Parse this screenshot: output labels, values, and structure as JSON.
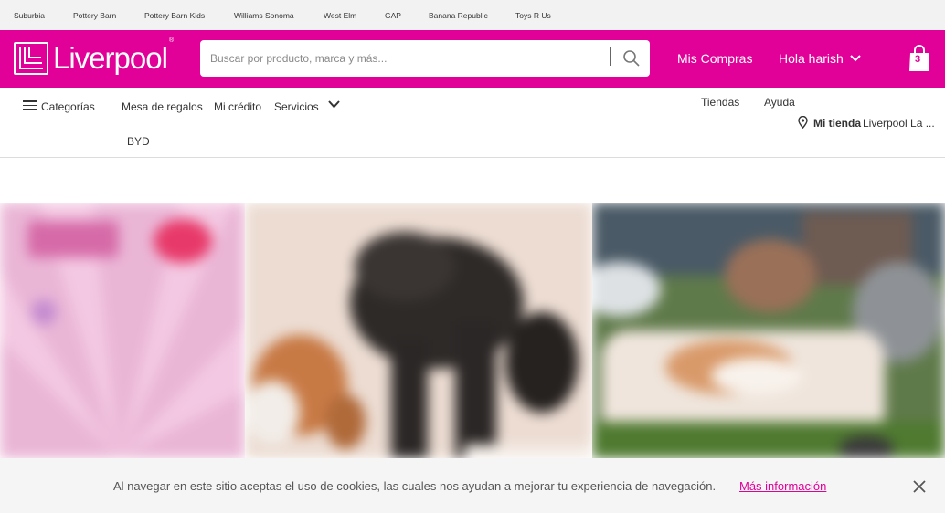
{
  "topbar": {
    "links": [
      "Suburbia",
      "Pottery Barn",
      "Pottery Barn Kids",
      "Williams Sonoma",
      "West Elm",
      "GAP",
      "Banana Republic",
      "Toys R Us"
    ]
  },
  "header": {
    "logo_text": "Liverpool",
    "logo_reg": "®",
    "search_placeholder": "Buscar por producto, marca y más...",
    "mis_compras": "Mis Compras",
    "greeting": "Hola harish",
    "cart_count": "3",
    "brand_color": "#e10098"
  },
  "nav": {
    "categorias": "Categorías",
    "mesa_regalos": "Mesa de regalos",
    "mi_credito": "Mi crédito",
    "servicios": "Servicios",
    "byd": "BYD",
    "tiendas": "Tiendas",
    "ayuda": "Ayuda",
    "mi_tienda_label": "Mi tienda",
    "mi_tienda_value": "Liverpool La ..."
  },
  "cookie": {
    "text": "Al navegar en este sitio aceptas el uso de cookies, las cuales nos ayudan a mejorar tu experiencia de navegación.",
    "link": "Más información"
  },
  "icons": {
    "search": "search-icon",
    "cart": "shopping-bag-icon",
    "menu": "hamburger-icon",
    "chevron": "chevron-down-icon",
    "location": "location-pin-icon",
    "close": "close-icon"
  }
}
